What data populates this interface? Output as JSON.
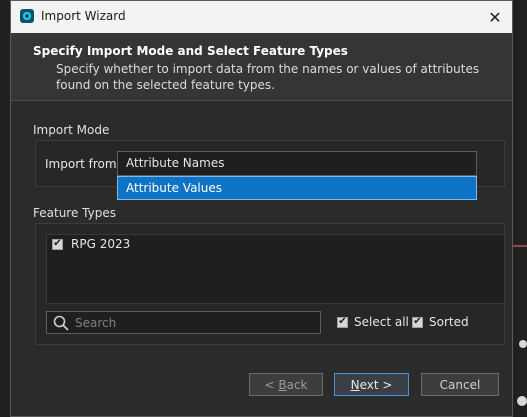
{
  "window": {
    "title": "Import Wizard",
    "close_glyph": "✕"
  },
  "header": {
    "title": "Specify Import Mode and Select Feature Types",
    "description": "Specify whether to import data from the names or values of attributes found on the selected feature types."
  },
  "import_mode": {
    "section_label": "Import Mode",
    "import_from_label": "Import from",
    "selected_value": "Attribute Names",
    "options": [
      "Attribute Names",
      "Attribute Values"
    ],
    "highlighted_option": "Attribute Values"
  },
  "feature_types": {
    "section_label": "Feature Types",
    "items": [
      {
        "label": "RPG 2023",
        "checked": true
      }
    ],
    "search_placeholder": "Search",
    "select_all_label": "Select all",
    "select_all_checked": true,
    "sorted_label": "Sorted",
    "sorted_checked": true
  },
  "buttons": {
    "back": {
      "prefix": "< ",
      "mnemonic": "B",
      "rest": "ack"
    },
    "next": {
      "mnemonic": "N",
      "rest": "ext >"
    },
    "cancel": "Cancel"
  },
  "colors": {
    "dialog_bg": "#2b2b2b",
    "header_bg": "#353535",
    "highlight": "#0e73c4",
    "primary_border": "#4a8fd9"
  },
  "icons": [
    "app-icon",
    "close-icon",
    "search-icon",
    "checkbox-icon"
  ]
}
